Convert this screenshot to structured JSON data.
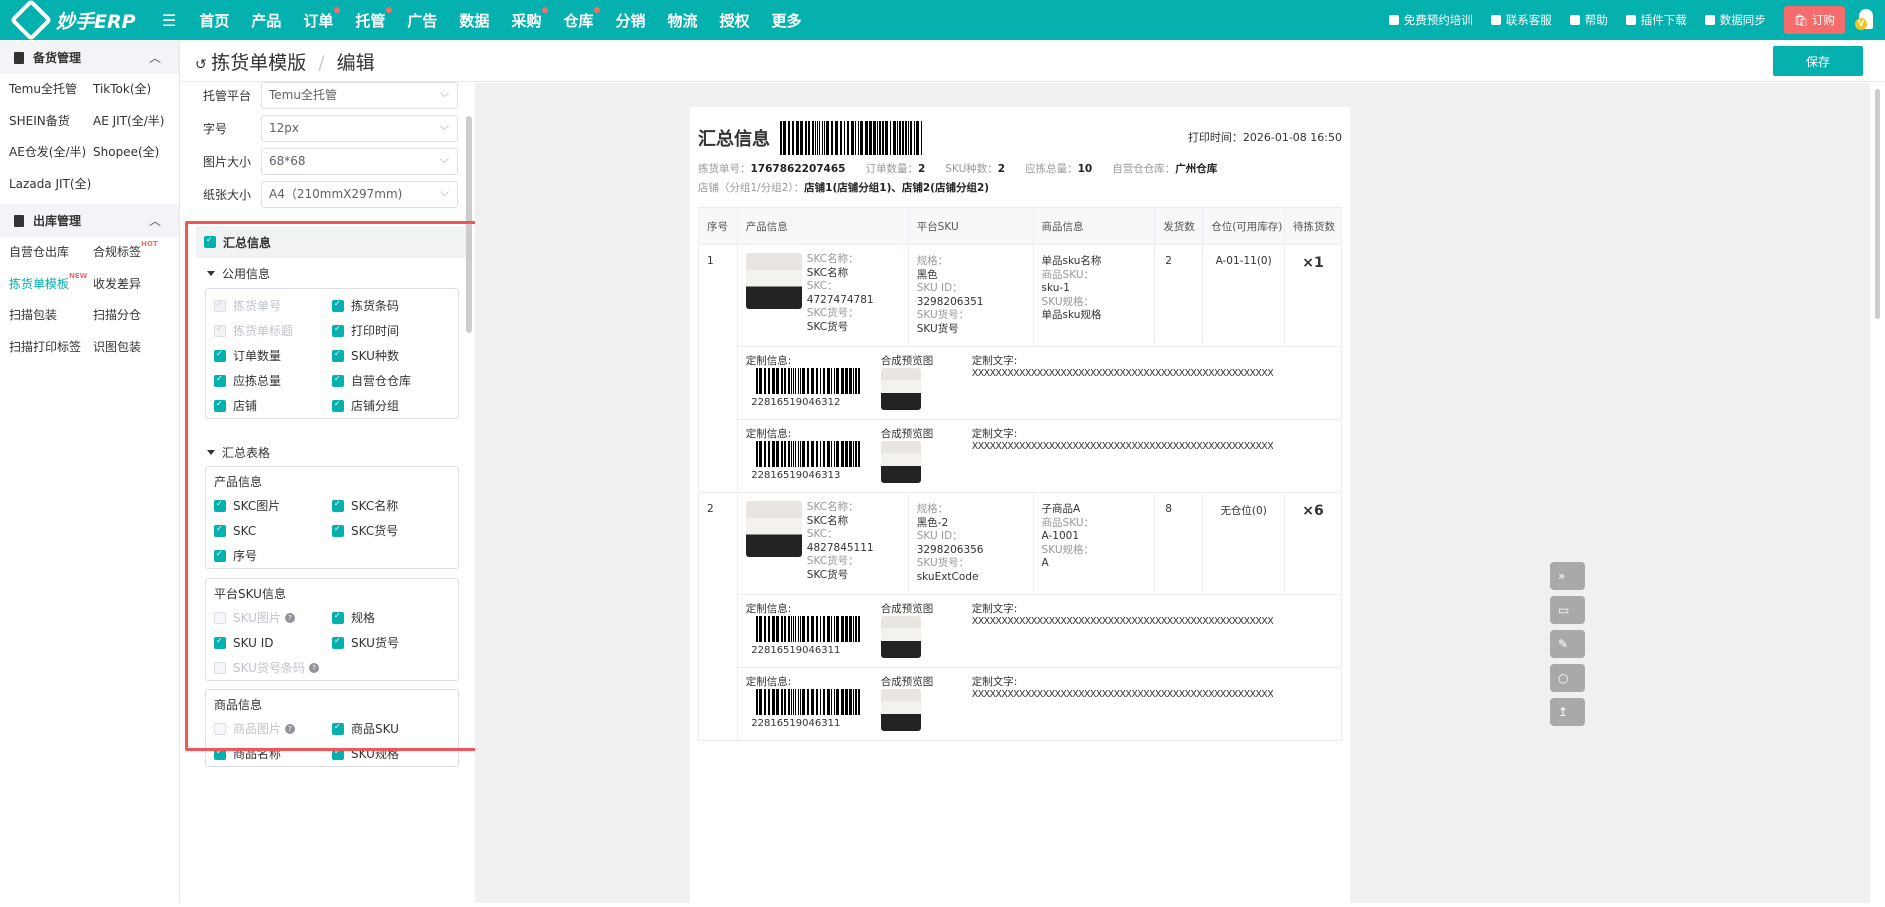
{
  "topbar": {
    "logo": "妙手ERP",
    "nav": [
      {
        "label": "首页",
        "dot": false
      },
      {
        "label": "产品",
        "dot": false
      },
      {
        "label": "订单",
        "dot": true
      },
      {
        "label": "托管",
        "dot": true
      },
      {
        "label": "广告",
        "dot": false
      },
      {
        "label": "数据",
        "dot": false
      },
      {
        "label": "采购",
        "dot": true
      },
      {
        "label": "仓库",
        "dot": true
      },
      {
        "label": "分销",
        "dot": false
      },
      {
        "label": "物流",
        "dot": false
      },
      {
        "label": "授权",
        "dot": false
      },
      {
        "label": "更多",
        "dot": false
      }
    ],
    "right": [
      {
        "label": "免费预约培训",
        "icon": "monitor-icon"
      },
      {
        "label": "联系客服",
        "icon": "chat-icon"
      },
      {
        "label": "帮助",
        "icon": "help-icon"
      },
      {
        "label": "插件下载",
        "icon": "download-icon"
      },
      {
        "label": "数据同步",
        "icon": "sync-icon"
      }
    ],
    "buy": "订购",
    "avatar_badge": "V"
  },
  "sidebar": {
    "sections": [
      {
        "title": "备货管理",
        "items": [
          {
            "label": "Temu全托管"
          },
          {
            "label": "TikTok(全)"
          },
          {
            "label": "SHEIN备货"
          },
          {
            "label": "AE JIT(全/半)"
          },
          {
            "label": "AE仓发(全/半)"
          },
          {
            "label": "Shopee(全)"
          },
          {
            "label": "Lazada JIT(全)"
          }
        ]
      },
      {
        "title": "出库管理",
        "items": [
          {
            "label": "自营仓出库"
          },
          {
            "label": "合规标签",
            "badge": "HOT"
          },
          {
            "label": "拣货单模板",
            "badge": "NEW",
            "active": true
          },
          {
            "label": "收发差异"
          },
          {
            "label": "扫描包装"
          },
          {
            "label": "扫描分仓"
          },
          {
            "label": "扫描打印标签"
          },
          {
            "label": "识图包装"
          }
        ]
      }
    ]
  },
  "header": {
    "back": "拣货单模版",
    "current": "编辑",
    "save": "保存"
  },
  "settings": {
    "fields": [
      {
        "label": "托管平台",
        "value": "Temu全托管"
      },
      {
        "label": "字号",
        "value": "12px"
      },
      {
        "label": "图片大小",
        "value": "68*68"
      },
      {
        "label": "纸张大小",
        "value": "A4（210mmX297mm)"
      }
    ],
    "group": "汇总信息",
    "public_title": "公用信息",
    "public": [
      {
        "label": "拣货单号",
        "state": "dis"
      },
      {
        "label": "拣货条码",
        "state": "on"
      },
      {
        "label": "拣货单标题",
        "state": "dis"
      },
      {
        "label": "打印时间",
        "state": "on"
      },
      {
        "label": "订单数量",
        "state": "on"
      },
      {
        "label": "SKU种数",
        "state": "on"
      },
      {
        "label": "应拣总量",
        "state": "on"
      },
      {
        "label": "自营仓仓库",
        "state": "on"
      },
      {
        "label": "店铺",
        "state": "on"
      },
      {
        "label": "店铺分组",
        "state": "on"
      }
    ],
    "table_title": "汇总表格",
    "boxes": [
      {
        "title": "产品信息",
        "opts": [
          {
            "label": "SKC图片",
            "state": "on"
          },
          {
            "label": "SKC名称",
            "state": "on"
          },
          {
            "label": "SKC",
            "state": "on"
          },
          {
            "label": "SKC货号",
            "state": "on"
          },
          {
            "label": "序号",
            "state": "on"
          }
        ]
      },
      {
        "title": "平台SKU信息",
        "opts": [
          {
            "label": "SKU图片",
            "state": "off",
            "help": true
          },
          {
            "label": "规格",
            "state": "on"
          },
          {
            "label": "SKU ID",
            "state": "on"
          },
          {
            "label": "SKU货号",
            "state": "on"
          },
          {
            "label": "SKU货号条码",
            "state": "off",
            "help": true
          }
        ]
      },
      {
        "title": "商品信息",
        "opts": [
          {
            "label": "商品图片",
            "state": "off",
            "help": true
          },
          {
            "label": "商品SKU",
            "state": "on"
          },
          {
            "label": "商品名称",
            "state": "on"
          },
          {
            "label": "SKU规格",
            "state": "on"
          }
        ]
      }
    ]
  },
  "preview": {
    "title": "汇总信息",
    "print_time": "打印时间：2026-01-08 16:50",
    "meta": [
      {
        "k": "拣货单号：",
        "v": "1767862207465"
      },
      {
        "k": "订单数量：",
        "v": "2"
      },
      {
        "k": "SKU种数：",
        "v": "2"
      },
      {
        "k": "应拣总量：",
        "v": "10"
      },
      {
        "k": "自营仓仓库：",
        "v": "广州仓库"
      }
    ],
    "shop_label": "店铺（分组1/分组2）：",
    "shop_value": "店铺1(店铺分组1)、店铺2(店铺分组2)",
    "columns": [
      "序号",
      "产品信息",
      "平台SKU",
      "商品信息",
      "发货数",
      "仓位(可用库存)",
      "待拣货数"
    ],
    "custom_labels": {
      "info": "定制信息:",
      "preview": "合成预览图",
      "text": "定制文字:"
    },
    "rows": [
      {
        "no": "1",
        "skc_name_l": "SKC名称：",
        "skc_name": "SKC名称",
        "skc_l": "SKC：",
        "skc": "4727474781",
        "skc_code_l": "SKC货号：",
        "skc_code": "SKC货号",
        "spec_l": "规格：",
        "spec": "黑色",
        "skuid_l": "SKU ID：",
        "skuid": "3298206351",
        "skucode_l": "SKU货号：",
        "skucode": "SKU货号",
        "goods": "单品sku名称",
        "gsku_l": "商品SKU：",
        "gsku": "sku-1",
        "gspec_l": "SKU规格：",
        "gspec": "单品sku规格",
        "ship": "2",
        "loc": "A-01-11(0)",
        "pick": "×1",
        "customs": [
          {
            "code": "22816519046312",
            "text": "XXXXXXXXXXXXXXXXXXXXXXXXXXXXXXXXXXXXXXXXXXXXXXXXXXX"
          },
          {
            "code": "22816519046313",
            "text": "XXXXXXXXXXXXXXXXXXXXXXXXXXXXXXXXXXXXXXXXXXXXXXXXXXX"
          }
        ]
      },
      {
        "no": "2",
        "skc_name_l": "SKC名称：",
        "skc_name": "SKC名称",
        "skc_l": "SKC：",
        "skc": "4827845111",
        "skc_code_l": "SKC货号：",
        "skc_code": "SKC货号",
        "spec_l": "规格：",
        "spec": "黑色-2",
        "skuid_l": "SKU ID：",
        "skuid": "3298206356",
        "skucode_l": "SKU货号：",
        "skucode": "skuExtCode",
        "goods": "子商品A",
        "gsku_l": "商品SKU：",
        "gsku": "A-1001",
        "gspec_l": "SKU规格：",
        "gspec": "A",
        "ship": "8",
        "loc": "无仓位(0)",
        "pick": "×6",
        "customs": [
          {
            "code": "22816519046311",
            "text": "XXXXXXXXXXXXXXXXXXXXXXXXXXXXXXXXXXXXXXXXXXXXXXXXXXX"
          },
          {
            "code": "22816519046311",
            "text": "XXXXXXXXXXXXXXXXXXXXXXXXXXXXXXXXXXXXXXXXXXXXXXXXXXX"
          }
        ]
      }
    ]
  },
  "colors": {
    "brand": "#05b1ae",
    "highlight": "#f35456",
    "badge": "#f56c6c"
  }
}
